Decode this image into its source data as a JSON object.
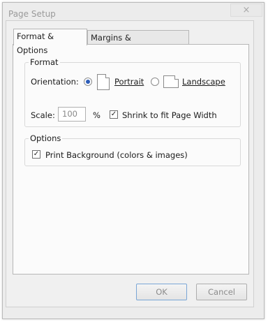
{
  "window": {
    "title": "Page Setup",
    "close_icon": "×"
  },
  "tabs": [
    {
      "label": "Format & Options",
      "active": true
    },
    {
      "label": "Margins & Header/Footer",
      "active": false
    }
  ],
  "format": {
    "group_title": "Format",
    "orientation_label": "Orientation:",
    "portrait_label": "Portrait",
    "portrait_selected": true,
    "landscape_label": "Landscape",
    "scale_label": "Scale:",
    "scale_value": "100",
    "percent_label": "%",
    "shrink_label": "Shrink to fit Page Width",
    "shrink_checked": true
  },
  "options": {
    "group_title": "Options",
    "print_background_label": "Print Background (colors & images)",
    "print_background_checked": true
  },
  "buttons": {
    "ok_label": "OK",
    "cancel_label": "Cancel"
  },
  "icons": {
    "check": "✓"
  }
}
